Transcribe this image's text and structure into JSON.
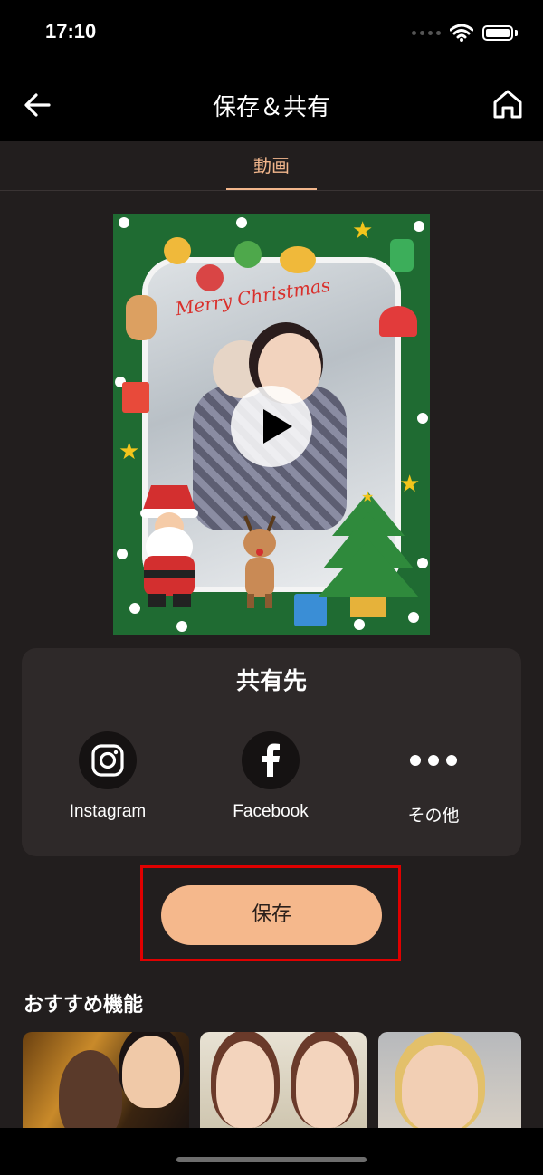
{
  "status_bar": {
    "time": "17:10"
  },
  "nav": {
    "title": "保存＆共有",
    "back_icon": "arrow-left-icon",
    "home_icon": "home-icon"
  },
  "tabs": [
    {
      "label": "動画",
      "active": true
    }
  ],
  "preview": {
    "greeting": "Merry Christmas",
    "play_icon": "play-icon"
  },
  "share": {
    "title": "共有先",
    "targets": [
      {
        "label": "Instagram",
        "icon": "instagram-icon"
      },
      {
        "label": "Facebook",
        "icon": "facebook-icon"
      },
      {
        "label": "その他",
        "icon": "more-icon"
      }
    ]
  },
  "save": {
    "label": "保存",
    "highlight_color": "#e00000",
    "button_color": "#f5b88c"
  },
  "recommended": {
    "title": "おすすめ機能"
  },
  "colors": {
    "accent": "#f2b68c",
    "background": "#221e1e",
    "card": "#2e2929"
  }
}
